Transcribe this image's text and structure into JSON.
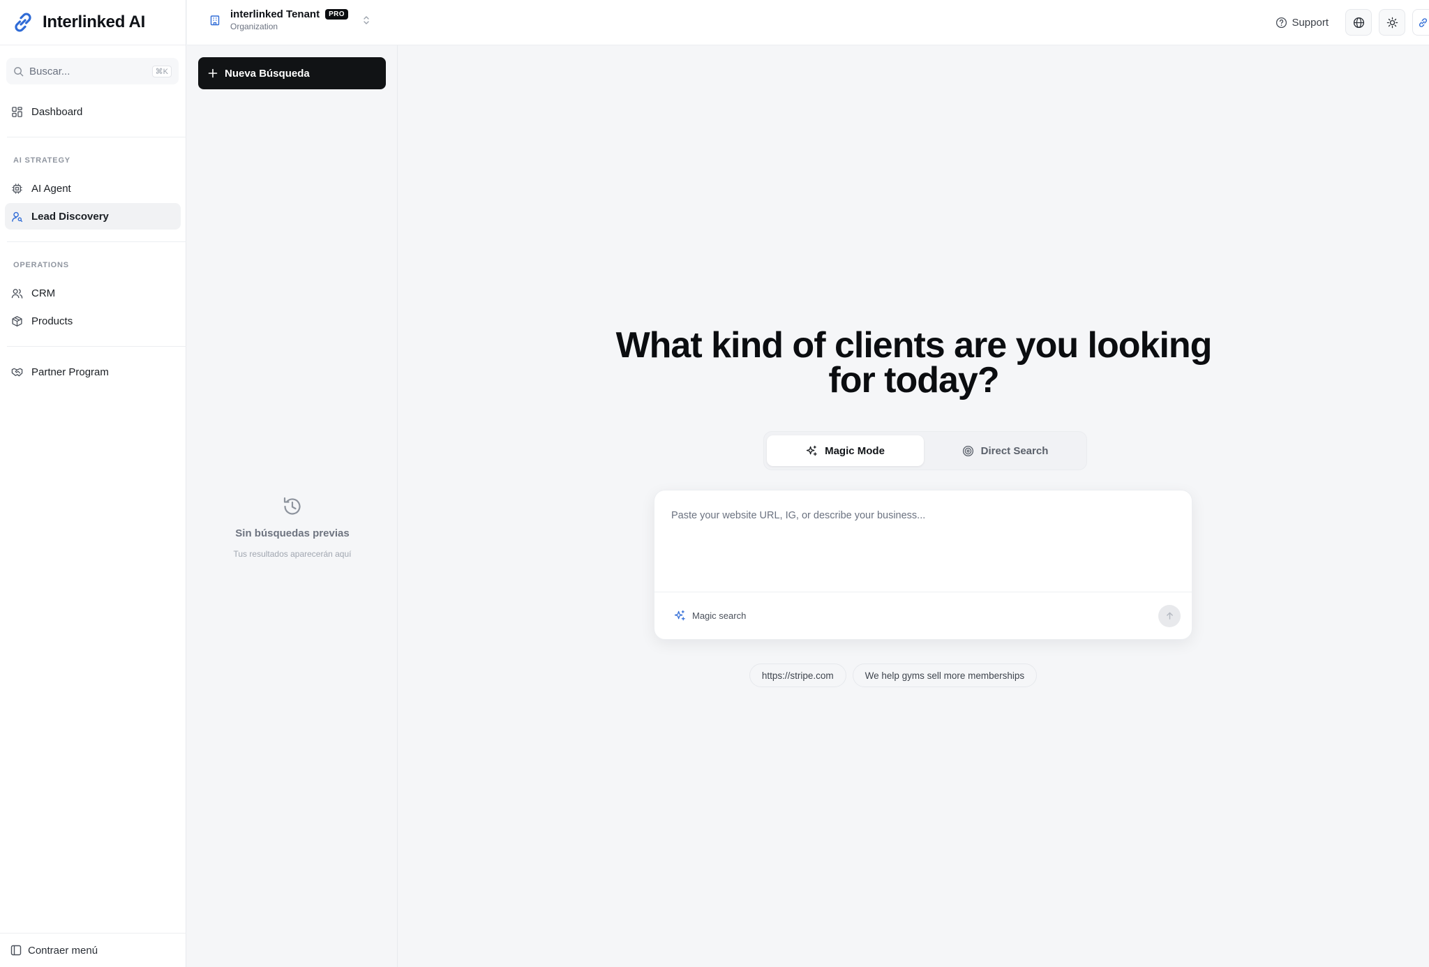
{
  "brand": {
    "name": "Interlinked AI"
  },
  "search": {
    "placeholder": "Buscar...",
    "shortcut": "⌘K"
  },
  "nav": {
    "dashboard": "Dashboard",
    "section_ai": "AI STRATEGY",
    "ai_agent": "AI Agent",
    "lead_discovery": "Lead Discovery",
    "section_ops": "OPERATIONS",
    "crm": "CRM",
    "products": "Products",
    "partner": "Partner Program",
    "collapse": "Contraer menú"
  },
  "tenant": {
    "name": "interlinked Tenant",
    "badge": "PRO",
    "type": "Organization"
  },
  "topbar": {
    "support": "Support"
  },
  "history": {
    "new_search": "Nueva Búsqueda",
    "empty_title": "Sin búsquedas previas",
    "empty_subtitle": "Tus resultados aparecerán aquí"
  },
  "main": {
    "headline_line1": "What kind of clients are you looking",
    "headline_line2": "for today?",
    "mode_magic": "Magic Mode",
    "mode_direct": "Direct Search",
    "prompt_placeholder": "Paste your website URL, IG, or describe your business...",
    "magic_search": "Magic search",
    "suggestion_1": "https://stripe.com",
    "suggestion_2": "We help gyms sell more memberships"
  },
  "colors": {
    "accent": "#2f6bd6",
    "dark_button": "#111315"
  }
}
